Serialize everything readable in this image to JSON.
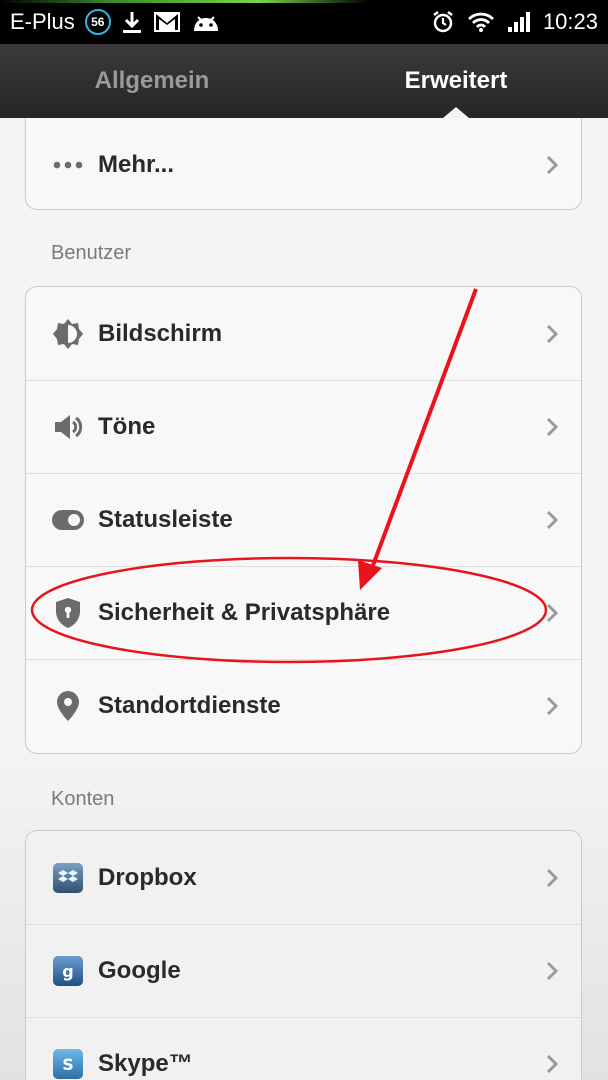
{
  "status_bar": {
    "carrier": "E-Plus",
    "badge": "56",
    "time": "10:23",
    "icons": [
      "download-icon",
      "gmail-icon",
      "android-icon",
      "alarm-icon",
      "wifi-icon",
      "signal-icon"
    ]
  },
  "tabs": [
    {
      "label": "Allgemein",
      "selected": false
    },
    {
      "label": "Erweitert",
      "selected": true
    }
  ],
  "top_card": {
    "items": [
      {
        "icon": "more-dots-icon",
        "label": "Mehr..."
      }
    ]
  },
  "sections": {
    "users": {
      "header": "Benutzer",
      "items": [
        {
          "icon": "brightness-icon",
          "label": "Bildschirm"
        },
        {
          "icon": "speaker-icon",
          "label": "Töne"
        },
        {
          "icon": "toggle-icon",
          "label": "Statusleiste"
        },
        {
          "icon": "shield-icon",
          "label": "Sicherheit & Privatsphäre"
        },
        {
          "icon": "location-pin-icon",
          "label": "Standortdienste"
        }
      ]
    },
    "accounts": {
      "header": "Konten",
      "items": [
        {
          "icon": "dropbox-icon",
          "label": "Dropbox"
        },
        {
          "icon": "google-icon",
          "label": "Google"
        },
        {
          "icon": "skype-icon",
          "label": "Skype™"
        }
      ]
    }
  },
  "colors": {
    "status_bar_bg": "#000000",
    "tab_bar_bg": "#2f2f2f",
    "annotation_red": "#e8141b",
    "badge_ring": "#33b5e5"
  }
}
